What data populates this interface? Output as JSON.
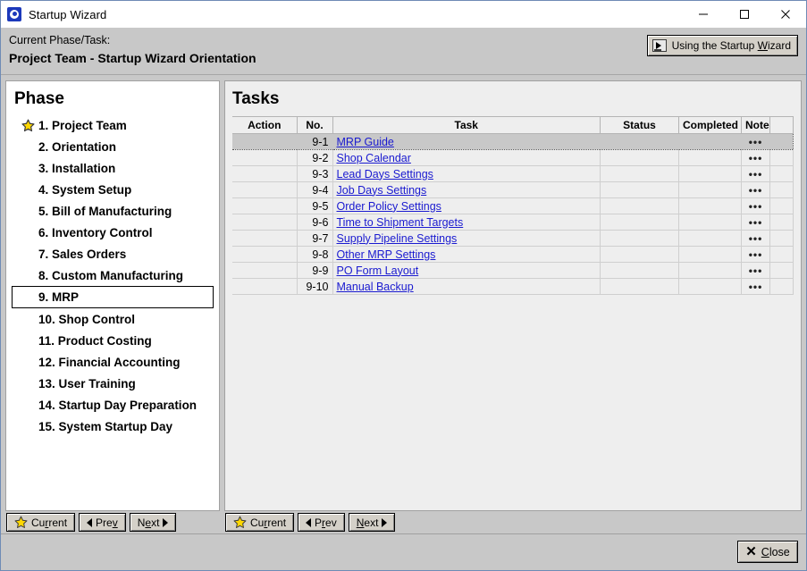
{
  "window": {
    "title": "Startup Wizard",
    "icon": "app-icon",
    "controls": {
      "minimize": "minimize-icon",
      "maximize": "maximize-icon",
      "close": "close-icon"
    }
  },
  "header": {
    "label": "Current Phase/Task:",
    "current": "Project Team - Startup Wizard Orientation",
    "wizard_button": {
      "label": "Using the Startup Wizard",
      "icon": "video-monitor-icon"
    }
  },
  "phase_panel": {
    "title": "Phase",
    "items": [
      {
        "label": "1. Project Team",
        "starred": true,
        "selected": false
      },
      {
        "label": "2. Orientation",
        "starred": false,
        "selected": false
      },
      {
        "label": "3. Installation",
        "starred": false,
        "selected": false
      },
      {
        "label": "4. System Setup",
        "starred": false,
        "selected": false
      },
      {
        "label": "5. Bill of Manufacturing",
        "starred": false,
        "selected": false
      },
      {
        "label": "6. Inventory Control",
        "starred": false,
        "selected": false
      },
      {
        "label": "7. Sales Orders",
        "starred": false,
        "selected": false
      },
      {
        "label": "8. Custom Manufacturing",
        "starred": false,
        "selected": false
      },
      {
        "label": "9. MRP",
        "starred": false,
        "selected": true
      },
      {
        "label": "10. Shop Control",
        "starred": false,
        "selected": false
      },
      {
        "label": "11. Product Costing",
        "starred": false,
        "selected": false
      },
      {
        "label": "12. Financial Accounting",
        "starred": false,
        "selected": false
      },
      {
        "label": "13. User Training",
        "starred": false,
        "selected": false
      },
      {
        "label": "14. Startup Day Preparation",
        "starred": false,
        "selected": false
      },
      {
        "label": "15. System Startup Day",
        "starred": false,
        "selected": false
      }
    ],
    "toolbar": {
      "current": "Current",
      "prev": "Prev",
      "next": "Next"
    }
  },
  "tasks_panel": {
    "title": "Tasks",
    "columns": [
      "Action",
      "No.",
      "Task",
      "Status",
      "Completed",
      "Note",
      ""
    ],
    "rows": [
      {
        "action": "",
        "no": "9-1",
        "task": "MRP Guide",
        "status": "",
        "completed": "",
        "note": "•••",
        "selected": true
      },
      {
        "action": "",
        "no": "9-2",
        "task": "Shop Calendar",
        "status": "",
        "completed": "",
        "note": "•••",
        "selected": false
      },
      {
        "action": "",
        "no": "9-3",
        "task": "Lead Days Settings",
        "status": "",
        "completed": "",
        "note": "•••",
        "selected": false
      },
      {
        "action": "",
        "no": "9-4",
        "task": "Job Days Settings",
        "status": "",
        "completed": "",
        "note": "•••",
        "selected": false
      },
      {
        "action": "",
        "no": "9-5",
        "task": "Order Policy Settings",
        "status": "",
        "completed": "",
        "note": "•••",
        "selected": false
      },
      {
        "action": "",
        "no": "9-6",
        "task": "Time to Shipment Targets",
        "status": "",
        "completed": "",
        "note": "•••",
        "selected": false
      },
      {
        "action": "",
        "no": "9-7",
        "task": "Supply Pipeline Settings",
        "status": "",
        "completed": "",
        "note": "•••",
        "selected": false
      },
      {
        "action": "",
        "no": "9-8",
        "task": "Other MRP Settings",
        "status": "",
        "completed": "",
        "note": "•••",
        "selected": false
      },
      {
        "action": "",
        "no": "9-9",
        "task": "PO Form Layout",
        "status": "",
        "completed": "",
        "note": "•••",
        "selected": false
      },
      {
        "action": "",
        "no": "9-10",
        "task": "Manual Backup",
        "status": "",
        "completed": "",
        "note": "•••",
        "selected": false
      }
    ],
    "toolbar": {
      "current": "Current",
      "prev": "Prev",
      "next": "Next"
    }
  },
  "footer": {
    "close_label": "Close"
  },
  "colors": {
    "window_chrome": "#c8c8c8",
    "phase_background": "#ffffff",
    "tasks_background": "#eeeeee",
    "link": "#1a1ad0",
    "selection": "#c8c8c8",
    "star": "#ffd700",
    "title_icon": "#1c39bb"
  }
}
